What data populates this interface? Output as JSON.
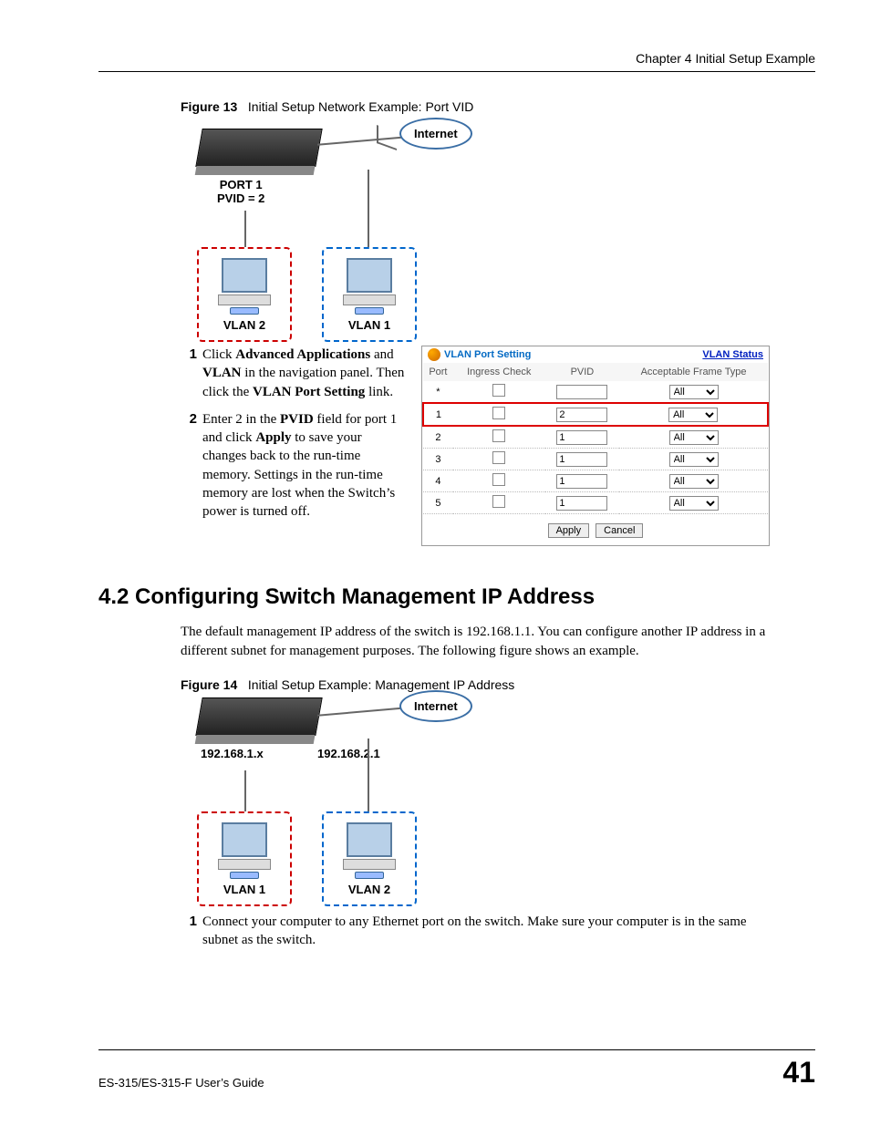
{
  "header": {
    "chapter": "Chapter 4 Initial Setup Example"
  },
  "figure13": {
    "caption_label": "Figure 13",
    "caption_text": "Initial Setup Network Example: Port VID",
    "cloud": "Internet",
    "port1_line1": "PORT 1",
    "port1_line2": "PVID = 2",
    "vlan_left": "VLAN 2",
    "vlan_right": "VLAN 1"
  },
  "steps13": {
    "s1_num": "1",
    "s1_pre": "Click ",
    "s1_b1": "Advanced Applications",
    "s1_mid1": " and ",
    "s1_b2": "VLAN",
    "s1_mid2": " in the navigation panel. Then click the ",
    "s1_b3": "VLAN Port Setting",
    "s1_post": " link.",
    "s2_num": "2",
    "s2_pre": "Enter 2 in the ",
    "s2_b1": "PVID",
    "s2_mid": " field for port 1 and click ",
    "s2_b2": "Apply",
    "s2_post": " to save your changes back to the run-time memory. Settings in the run-time memory are lost when the Switch’s power is turned off."
  },
  "vlan_panel": {
    "title": "VLAN Port Setting",
    "status_link": "VLAN Status",
    "col_port": "Port",
    "col_ingress": "Ingress Check",
    "col_pvid": "PVID",
    "col_aft": "Acceptable Frame Type",
    "rows": [
      {
        "port": "*",
        "pvid": "",
        "aft": "All",
        "hi": false
      },
      {
        "port": "1",
        "pvid": "2",
        "aft": "All",
        "hi": true
      },
      {
        "port": "2",
        "pvid": "1",
        "aft": "All",
        "hi": false
      },
      {
        "port": "3",
        "pvid": "1",
        "aft": "All",
        "hi": false
      },
      {
        "port": "4",
        "pvid": "1",
        "aft": "All",
        "hi": false
      },
      {
        "port": "5",
        "pvid": "1",
        "aft": "All",
        "hi": false
      }
    ],
    "apply": "Apply",
    "cancel": "Cancel"
  },
  "section42": {
    "heading": "4.2  Configuring Switch Management IP Address",
    "para": "The default management IP address of the switch is 192.168.1.1. You can configure another IP address in a different subnet for management purposes. The following figure shows an example."
  },
  "figure14": {
    "caption_label": "Figure 14",
    "caption_text": "Initial Setup Example: Management IP Address",
    "cloud": "Internet",
    "ip_left": "192.168.1.x",
    "ip_right": "192.168.2.1",
    "vlan_left": "VLAN 1",
    "vlan_right": "VLAN 2"
  },
  "steps14": {
    "s1_num": "1",
    "s1_text": "Connect your computer to any Ethernet port on the switch. Make sure your computer is in the same subnet as the switch."
  },
  "footer": {
    "guide": "ES-315/ES-315-F User’s Guide",
    "page": "41"
  }
}
